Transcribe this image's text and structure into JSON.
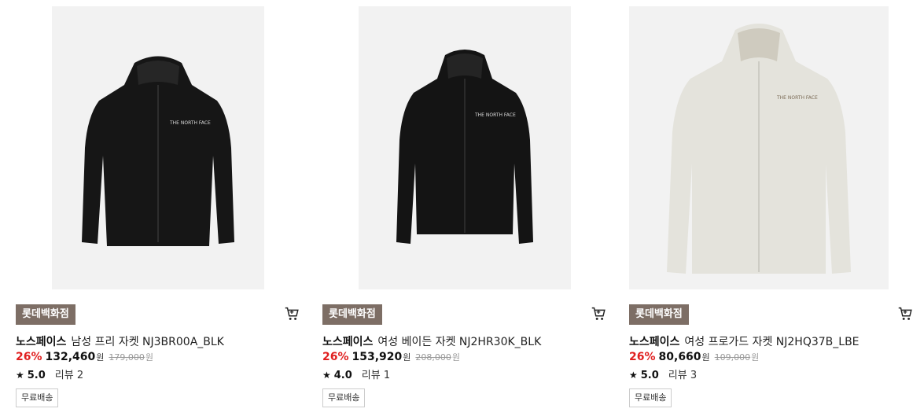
{
  "products": [
    {
      "store": "롯데백화점",
      "brand": "노스페이스",
      "name": "남성 프리 자켓 NJ3BR00A_BLK",
      "discount": "26%",
      "price": "132,460",
      "price_unit": "원",
      "original_price": "179,000",
      "original_unit": "원",
      "rating": "5.0",
      "reviews": "리뷰 2",
      "shipping": "무료배송",
      "image": "black-mens-hooded-jacket",
      "jacket_color": "#161616"
    },
    {
      "store": "롯데백화점",
      "brand": "노스페이스",
      "name": "여성 베이든 자켓 NJ2HR30K_BLK",
      "discount": "26%",
      "price": "153,920",
      "price_unit": "원",
      "original_price": "208,000",
      "original_unit": "원",
      "rating": "4.0",
      "reviews": "리뷰 1",
      "shipping": "무료배송",
      "image": "black-womens-cropped-jacket",
      "jacket_color": "#141414"
    },
    {
      "store": "롯데백화점",
      "brand": "노스페이스",
      "name": "여성 프로가드 자켓 NJ2HQ37B_LBE",
      "discount": "26%",
      "price": "80,660",
      "price_unit": "원",
      "original_price": "109,000",
      "original_unit": "원",
      "rating": "5.0",
      "reviews": "리뷰 3",
      "shipping": "무료배송",
      "image": "light-beige-womens-jacket",
      "jacket_color": "#e4e3dc"
    }
  ],
  "colors": {
    "store_badge": "#7d6e65",
    "discount": "#e02020",
    "image_bg": "#f2f2f2"
  }
}
